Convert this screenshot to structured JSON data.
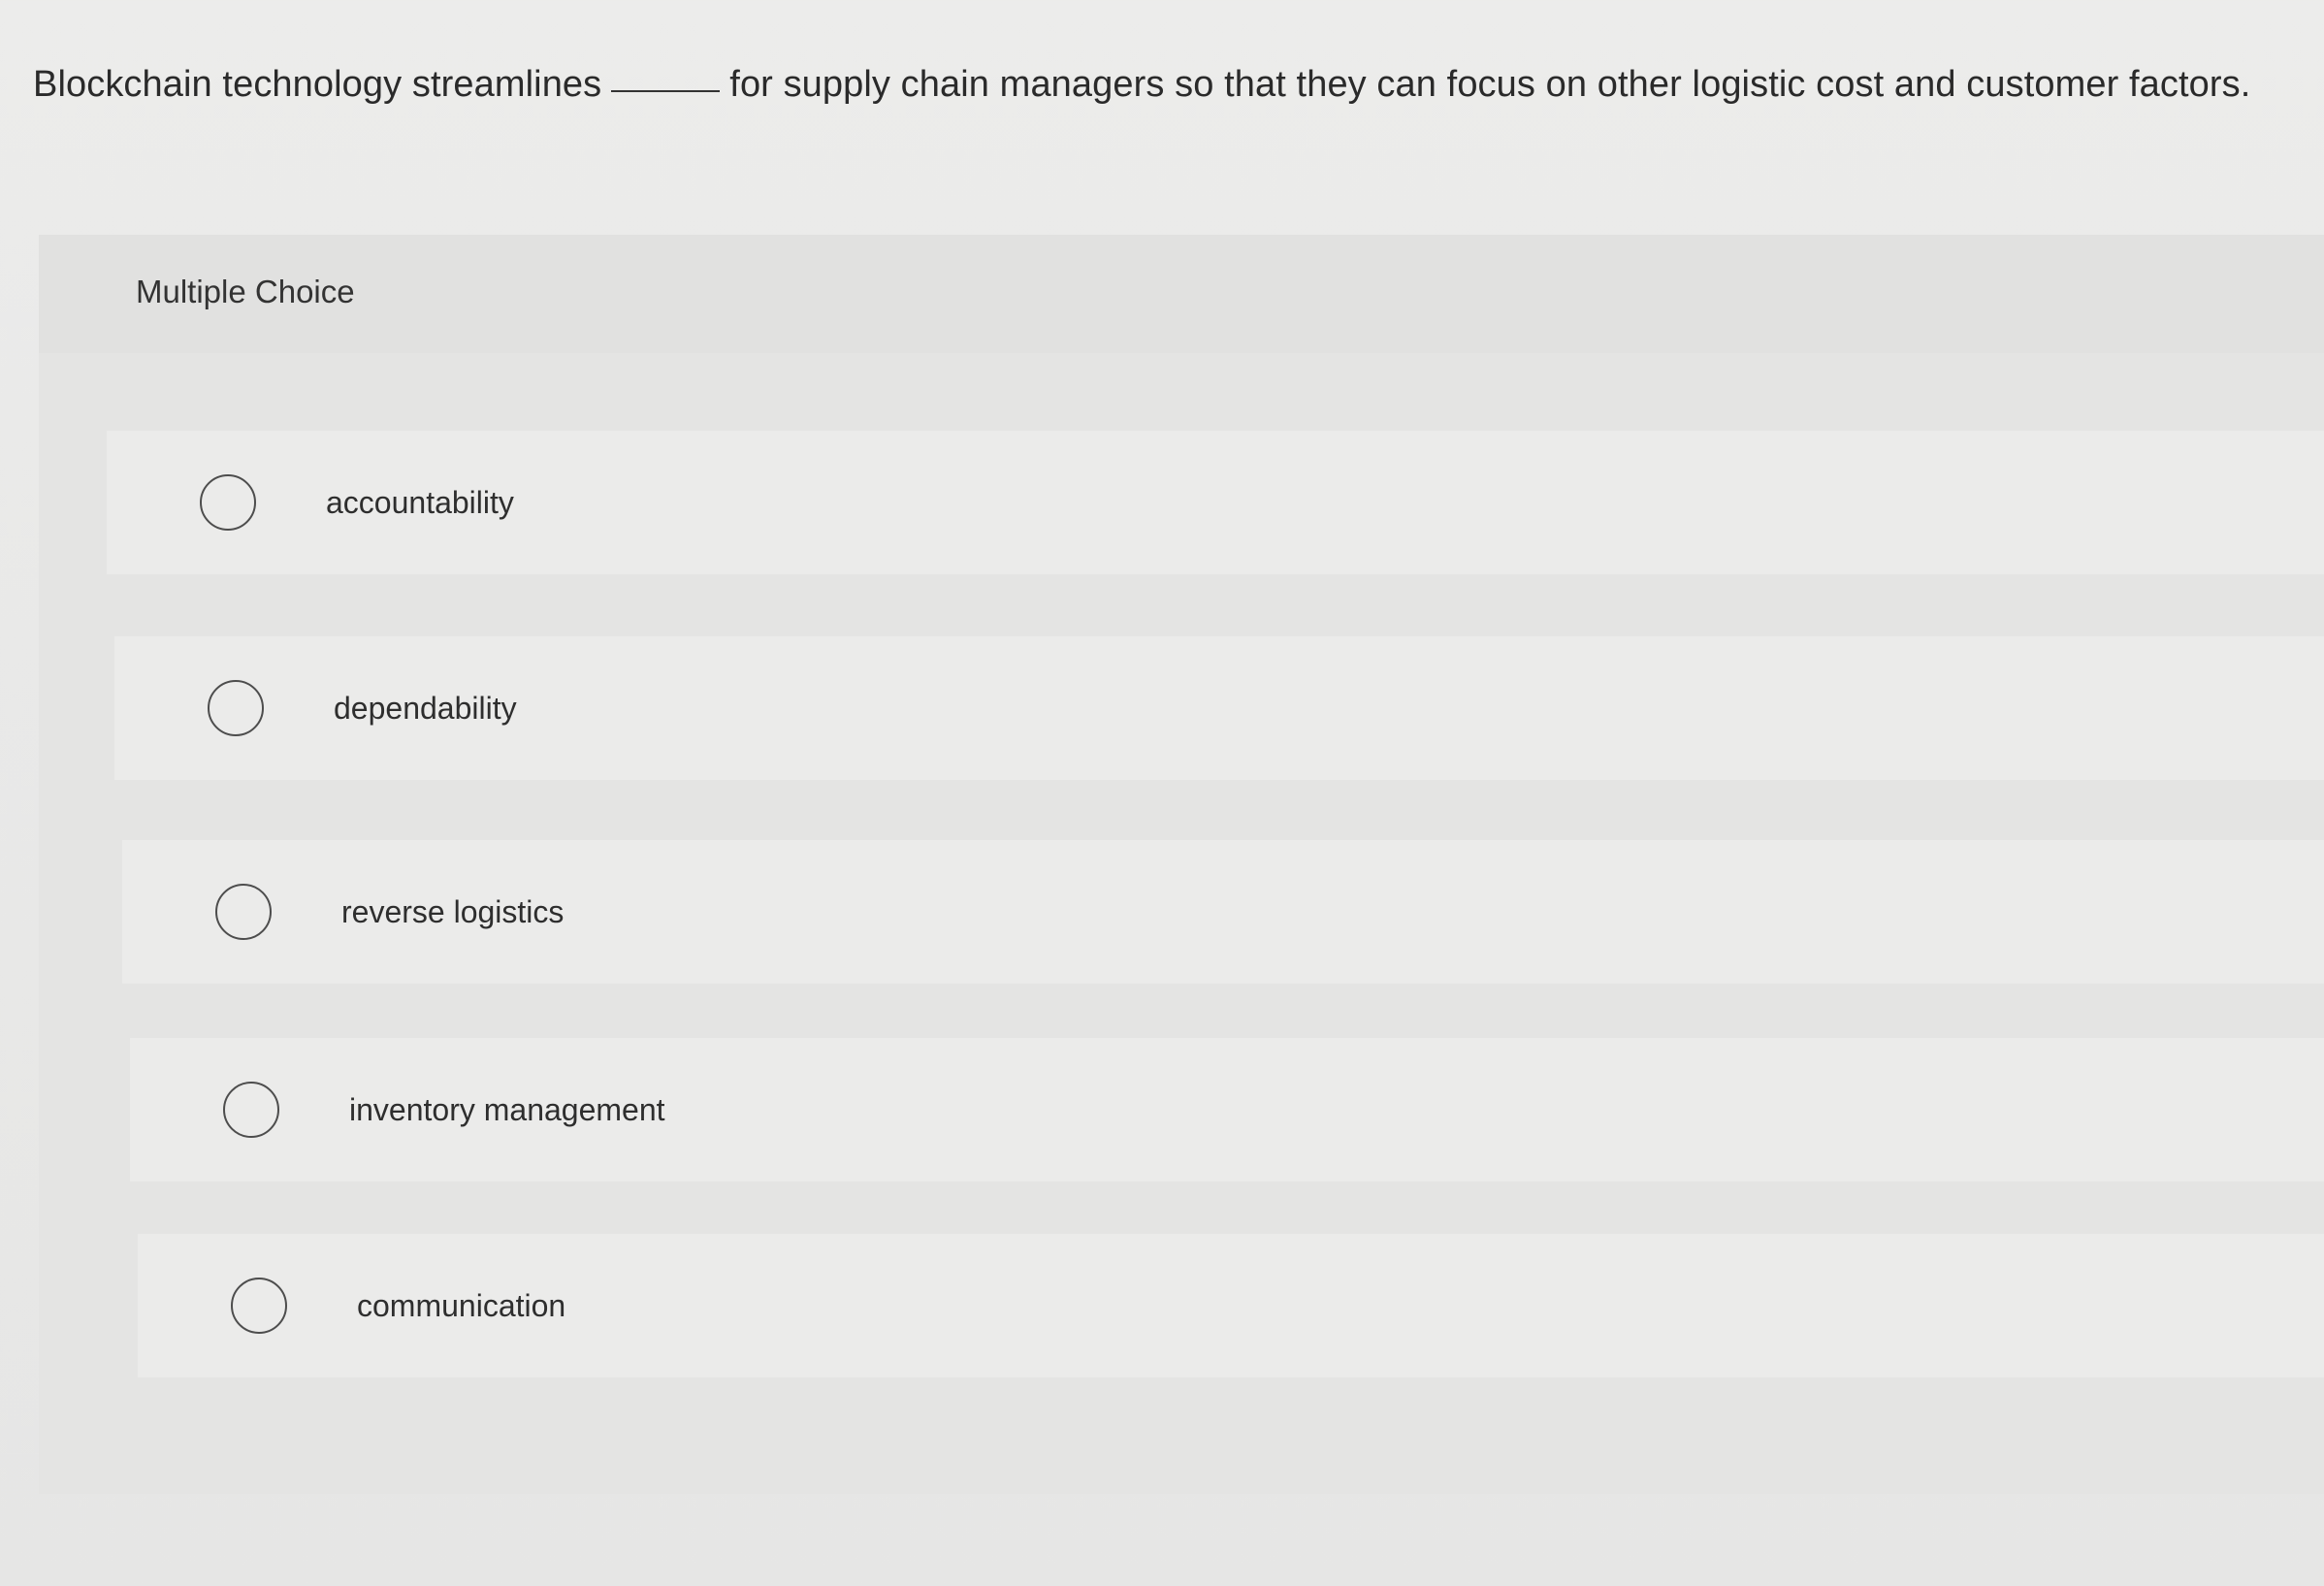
{
  "question": {
    "before_blank": "Blockchain technology streamlines",
    "after_blank": "for supply chain managers so that they can focus on other logistic cost and customer factors."
  },
  "multiple_choice": {
    "title": "Multiple Choice",
    "options": [
      {
        "label": "accountability",
        "icon": "radio-circle-icon",
        "selected": false
      },
      {
        "label": "dependability",
        "icon": "radio-circle-icon",
        "selected": false
      },
      {
        "label": "reverse logistics",
        "icon": "radio-circle-icon",
        "selected": false
      },
      {
        "label": "inventory management",
        "icon": "radio-circle-icon",
        "selected": false
      },
      {
        "label": "communication",
        "icon": "radio-circle-icon",
        "selected": false
      }
    ]
  },
  "colors": {
    "background": "#e9e9e8",
    "panel": "#e4e4e3",
    "option_row": "#ebebea",
    "text": "#2b2b2b",
    "radio_border": "#4d4d4d"
  }
}
